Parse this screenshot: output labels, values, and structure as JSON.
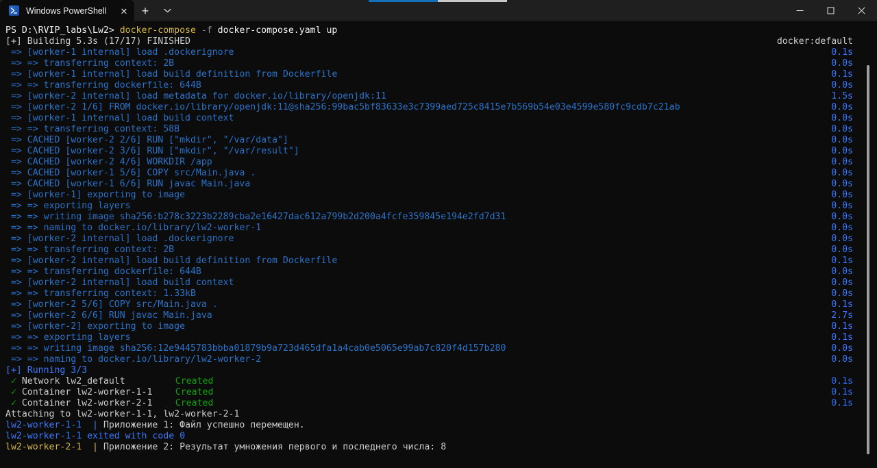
{
  "window": {
    "tab_title": "Windows PowerShell",
    "tab_icon": "powershell-icon",
    "close_glyph": "✕",
    "new_tab_glyph": "+",
    "tab_menu_glyph": "⌄",
    "minimize_glyph": "─",
    "maximize_glyph": "□",
    "window_close_glyph": "✕"
  },
  "terminal": {
    "prompt_prefix": "PS D:\\RVIP_labs\\Lw2> ",
    "command_name": "docker-compose",
    "command_flag": " -f ",
    "command_args": "docker-compose.yaml up",
    "build_header": "[+] Building 5.3s (17/17) FINISHED",
    "build_header_right": "docker:default",
    "running_header": "[+] Running 3/3",
    "attaching_line": "Attaching to lw2-worker-1-1, lw2-worker-2-1",
    "check_glyph": "✓",
    "pipe_glyph": "|",
    "steps": [
      {
        "text": " => [worker-1 internal] load .dockerignore",
        "time": "0.1s"
      },
      {
        "text": " => => transferring context: 2B",
        "time": "0.0s"
      },
      {
        "text": " => [worker-1 internal] load build definition from Dockerfile",
        "time": "0.1s"
      },
      {
        "text": " => => transferring dockerfile: 644B",
        "time": "0.0s"
      },
      {
        "text": " => [worker-2 internal] load metadata for docker.io/library/openjdk:11",
        "time": "1.5s"
      },
      {
        "text": " => [worker-2 1/6] FROM docker.io/library/openjdk:11@sha256:99bac5bf83633e3c7399aed725c8415e7b569b54e03e4599e580fc9cdb7c21ab",
        "time": "0.0s"
      },
      {
        "text": " => [worker-1 internal] load build context",
        "time": "0.0s"
      },
      {
        "text": " => => transferring context: 58B",
        "time": "0.0s"
      },
      {
        "text": " => CACHED [worker-2 2/6] RUN [\"mkdir\", \"/var/data\"]",
        "time": "0.0s"
      },
      {
        "text": " => CACHED [worker-2 3/6] RUN [\"mkdir\", \"/var/result\"]",
        "time": "0.0s"
      },
      {
        "text": " => CACHED [worker-2 4/6] WORKDIR /app",
        "time": "0.0s"
      },
      {
        "text": " => CACHED [worker-1 5/6] COPY src/Main.java .",
        "time": "0.0s"
      },
      {
        "text": " => CACHED [worker-1 6/6] RUN javac Main.java",
        "time": "0.0s"
      },
      {
        "text": " => [worker-1] exporting to image",
        "time": "0.0s"
      },
      {
        "text": " => => exporting layers",
        "time": "0.0s"
      },
      {
        "text": " => => writing image sha256:b278c3223b2289cba2e16427dac612a799b2d200a4fcfe359845e194e2fd7d31",
        "time": "0.0s"
      },
      {
        "text": " => => naming to docker.io/library/lw2-worker-1",
        "time": "0.0s"
      },
      {
        "text": " => [worker-2 internal] load .dockerignore",
        "time": "0.0s"
      },
      {
        "text": " => => transferring context: 2B",
        "time": "0.0s"
      },
      {
        "text": " => [worker-2 internal] load build definition from Dockerfile",
        "time": "0.1s"
      },
      {
        "text": " => => transferring dockerfile: 644B",
        "time": "0.0s"
      },
      {
        "text": " => [worker-2 internal] load build context",
        "time": "0.0s"
      },
      {
        "text": " => => transferring context: 1.33kB",
        "time": "0.0s"
      },
      {
        "text": " => [worker-2 5/6] COPY src/Main.java .",
        "time": "0.1s"
      },
      {
        "text": " => [worker-2 6/6] RUN javac Main.java",
        "time": "2.7s"
      },
      {
        "text": " => [worker-2] exporting to image",
        "time": "0.1s"
      },
      {
        "text": " => => exporting layers",
        "time": "0.1s"
      },
      {
        "text": " => => writing image sha256:12e9445783bbba01879b9a723d465dfa1a4cab0e5065e99ab7c820f4d157b280",
        "time": "0.0s"
      },
      {
        "text": " => => naming to docker.io/library/lw2-worker-2",
        "time": "0.0s"
      }
    ],
    "resources": [
      {
        "name": "Network lw2_default",
        "status": "Created",
        "time": "0.1s"
      },
      {
        "name": "Container lw2-worker-1-1",
        "status": "Created",
        "time": "0.1s"
      },
      {
        "name": "Container lw2-worker-2-1",
        "status": "Created",
        "time": "0.1s"
      }
    ],
    "logs": [
      {
        "service": "lw2-worker-1-1",
        "color": "blue",
        "message": "Приложение 1: Файл успешно перемещен."
      },
      {
        "service": "lw2-worker-1-1",
        "color": "blue",
        "message": "",
        "exit_text": " exited with code 0"
      },
      {
        "service": "lw2-worker-2-1",
        "color": "yellow",
        "message": "Приложение 2: Результат умножения первого и последнего числа: 8"
      }
    ]
  },
  "colors": {
    "background": "#0c0c0c",
    "titlebar": "#1f1f1f",
    "blue": "#2b72c9",
    "bright_blue": "#3b78ff",
    "green": "#13a10e",
    "yellow": "#c19c00",
    "white": "#cccccc",
    "accent": "#1570b8"
  }
}
